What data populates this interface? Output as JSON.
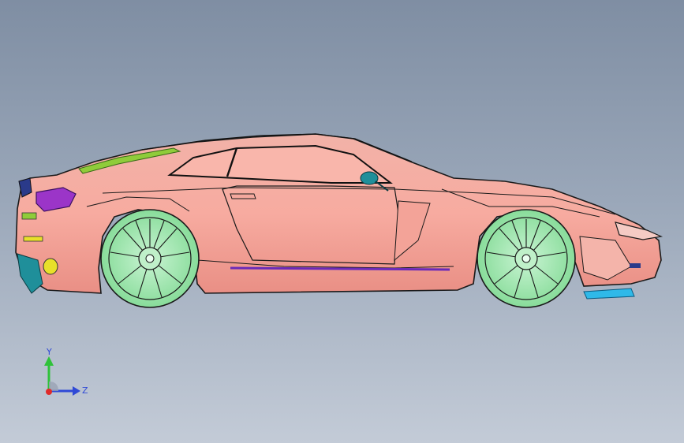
{
  "viewport": {
    "background_top": "#7f8ea3",
    "background_bottom": "#c3cbd7"
  },
  "model": {
    "body_color": "#f6aea4",
    "edge_color": "#1a1a1a",
    "wheel_color": "#98e6a8",
    "headlight_color": "#9b35c8",
    "mirror_color": "#1f8f9a",
    "accent_yellow": "#e8e02a",
    "accent_green": "#8fcc3a",
    "splitter_color": "#2fb9e8"
  },
  "triad": {
    "y_label": "Y",
    "z_label": "Z",
    "y_color": "#2fc23a",
    "z_color": "#2f49d6",
    "x_color": "#e02a2a"
  }
}
